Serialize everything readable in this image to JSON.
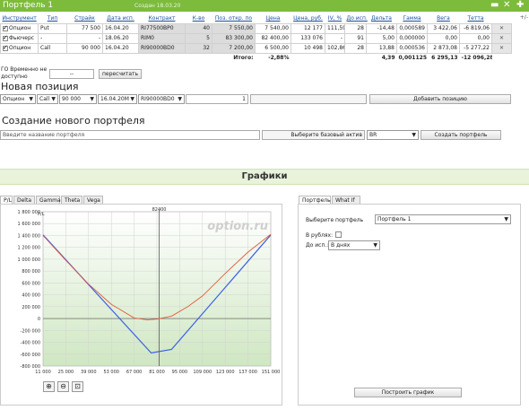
{
  "window": {
    "title": "Портфель 1",
    "created": "Создан 18.03.20",
    "hint": "+/-"
  },
  "table": {
    "headers": [
      "Инструмент",
      "Тип",
      "Страйк",
      "Дата исп.",
      "Контракт",
      "К-во",
      "Поз. откр. по",
      "Цена",
      "Цена, руб.",
      "IV, %",
      "До исп.",
      "Дельта",
      "Гамма",
      "Вега",
      "Тетта"
    ],
    "rows": [
      {
        "instrument": "Опцион",
        "type": "Put",
        "strike": "77 500",
        "date": "16.04.20",
        "contract": "RI77500BP0",
        "qty": "40",
        "open": "7 550,00",
        "price": "7 540,00",
        "price_rub": "12 177",
        "iv": "111,59",
        "days": "28",
        "delta": "-14,48",
        "gamma": "0,000589",
        "vega": "3 422,06",
        "theta": "-6 819,06"
      },
      {
        "instrument": "Фьючерс",
        "type": "-",
        "strike": "-",
        "date": "18.06.20",
        "contract": "RIM0",
        "qty": "5",
        "open": "83 300,00",
        "price": "82 400,00",
        "price_rub": "133 076",
        "iv": "-",
        "days": "91",
        "delta": "5,00",
        "gamma": "0,000000",
        "vega": "0,00",
        "theta": "0,00"
      },
      {
        "instrument": "Опцион",
        "type": "Call",
        "strike": "90 000",
        "date": "16.04.20",
        "contract": "RI90000BD0",
        "qty": "32",
        "open": "7 200,00",
        "price": "6 500,00",
        "price_rub": "10 498",
        "iv": "102,86",
        "days": "28",
        "delta": "13,88",
        "gamma": "0,000536",
        "vega": "2 873,08",
        "theta": "-5 277,22"
      }
    ],
    "totals": {
      "label": "Итого:",
      "pct": "-2,88%",
      "delta": "4,39",
      "gamma": "0,001125",
      "vega": "6 295,13",
      "theta": "-12 096,28"
    },
    "remove_icon": "close-icon"
  },
  "go": {
    "label": "ГО Временно не доступно",
    "value": "--",
    "recalc_label": "пересчитать"
  },
  "new_position": {
    "title": "Новая позиция",
    "instrument": "Опцион",
    "type": "Call",
    "strike": "90 000",
    "date": "16.04.20M",
    "contract": "RI90000BD0",
    "qty": "1",
    "add_label": "Добавить позицию"
  },
  "new_portfolio": {
    "title": "Создание нового портфеля",
    "name_placeholder": "Введите название портфеля",
    "base_label": "Выберите базовый актив",
    "base_value": "BR",
    "create_label": "Создать портфель"
  },
  "charts_section": {
    "title": "Графики"
  },
  "chart_tabs": [
    "P/L",
    "Delta",
    "Gamma",
    "Theta",
    "Vega"
  ],
  "right_tabs": [
    "Портфель",
    "What If"
  ],
  "settings": {
    "portfolio_label": "Выберите портфель",
    "portfolio_value": "Портфель 1",
    "rub_label": "В рублях:",
    "exp_label": "До исп.:",
    "exp_value": "В днях",
    "build_label": "Построить график"
  },
  "zoom_icons": [
    "zoom-in-icon",
    "zoom-out-icon",
    "zoom-fit-icon"
  ],
  "chart_data": {
    "type": "line",
    "ylabel": "P/L",
    "watermark": "option.ru",
    "current_price_label": "82400",
    "current_price": 82400,
    "xlim": [
      11000,
      151000
    ],
    "ylim": [
      -800000,
      1800000
    ],
    "xticks": [
      11000,
      25000,
      39000,
      53000,
      67000,
      81000,
      95000,
      109000,
      123000,
      137000,
      151000
    ],
    "xtick_labels": [
      "11 000",
      "25 000",
      "39 000",
      "53 000",
      "67 000",
      "81 000",
      "95 000",
      "109 000",
      "123 000",
      "137 000",
      "151 000"
    ],
    "yticks": [
      -800000,
      -600000,
      -400000,
      -200000,
      0,
      200000,
      400000,
      600000,
      800000,
      1000000,
      1200000,
      1400000,
      1600000,
      1800000
    ],
    "ytick_labels": [
      "-800 000",
      "-600 000",
      "-400 000",
      "-200 000",
      "0",
      "200 000",
      "400 000",
      "600 000",
      "800 000",
      "1 000 000",
      "1 200 000",
      "1 400 000",
      "1 600 000",
      "1 800 000"
    ],
    "series": [
      {
        "color": "#3a5fe8",
        "x": [
          11000,
          77500,
          90000,
          151000
        ],
        "y": [
          1410000,
          -580000,
          -520000,
          1410000
        ]
      },
      {
        "color": "#e35a3a",
        "x": [
          11000,
          25000,
          39000,
          53000,
          67000,
          75000,
          81000,
          90000,
          100000,
          109000,
          123000,
          137000,
          151000
        ],
        "y": [
          1400000,
          980000,
          580000,
          240000,
          10000,
          -20000,
          -10000,
          40000,
          200000,
          380000,
          760000,
          1120000,
          1420000
        ]
      }
    ]
  }
}
